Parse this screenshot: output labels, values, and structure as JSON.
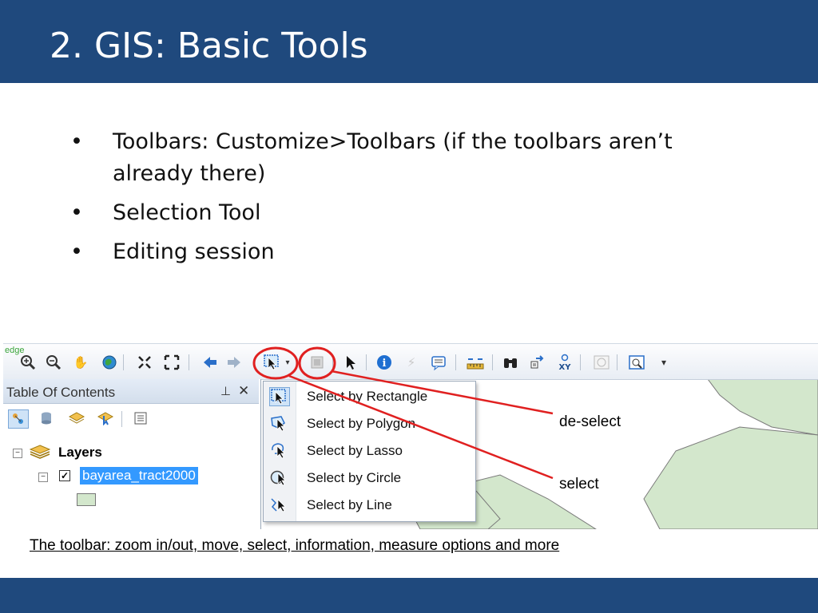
{
  "slide": {
    "title": "2. GIS: Basic Tools",
    "bullets": [
      "Toolbars: Customize>Toolbars (if the toolbars aren’t already there)",
      "Selection Tool",
      "Editing session"
    ],
    "bullet_char": "•",
    "caption": "The toolbar: zoom in/out, move, select, information, measure options and more"
  },
  "toolbar": {
    "edge_label": "edge",
    "icons": [
      "zoom-in-icon",
      "zoom-out-icon",
      "pan-hand-icon",
      "full-extent-globe-icon",
      "fixed-zoom-in-icon",
      "fixed-zoom-out-icon",
      "back-arrow-icon",
      "forward-arrow-icon",
      "select-features-icon",
      "clear-selection-icon",
      "select-elements-icon",
      "identify-icon",
      "hyperlink-icon",
      "html-popup-icon",
      "measure-icon",
      "find-icon",
      "find-route-icon",
      "go-to-xy-icon",
      "time-slider-icon",
      "create-viewer-window-icon"
    ]
  },
  "toc": {
    "title": "Table Of Contents",
    "pin_glyph": "⊥",
    "close_glyph": "✕",
    "layers_label": "Layers",
    "layer_name": "bayarea_tract2000",
    "expander_glyph": "−",
    "check_glyph": "✓"
  },
  "select_menu": {
    "items": [
      {
        "label": "Select by Rectangle",
        "icon": "select-rectangle-icon"
      },
      {
        "label": "Select by Polygon",
        "icon": "select-polygon-icon"
      },
      {
        "label": "Select by Lasso",
        "icon": "select-lasso-icon"
      },
      {
        "label": "Select by Circle",
        "icon": "select-circle-icon"
      },
      {
        "label": "Select by Line",
        "icon": "select-line-icon"
      }
    ]
  },
  "callouts": {
    "deselect": "de-select",
    "select": "select"
  },
  "colors": {
    "header": "#1f497d",
    "annotation_red": "#e02020",
    "map_polygon_fill": "#d3e7cc",
    "selection_highlight": "#3399ff"
  }
}
